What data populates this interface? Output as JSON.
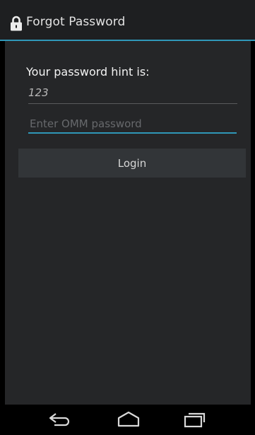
{
  "action_bar": {
    "title": "Forgot Password",
    "icon": "lock-icon",
    "accent_color": "#2f97b8"
  },
  "form": {
    "hint_label": "Your password hint is:",
    "hint_value": "123",
    "password_placeholder": "Enter OMM password",
    "password_value": "",
    "login_label": "Login"
  },
  "nav_bar": {
    "icons": [
      "back-icon",
      "home-icon",
      "recent-apps-icon"
    ]
  }
}
